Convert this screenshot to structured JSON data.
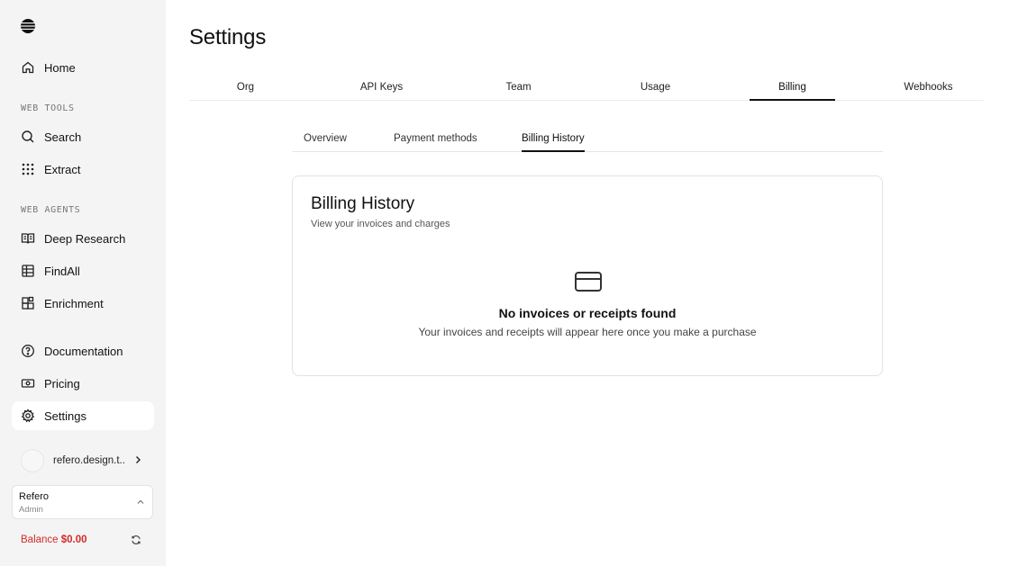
{
  "sidebar": {
    "nav": {
      "home": "Home",
      "search": "Search",
      "extract": "Extract",
      "deep_research": "Deep Research",
      "findall": "FindAll",
      "enrichment": "Enrichment",
      "documentation": "Documentation",
      "pricing": "Pricing",
      "settings": "Settings"
    },
    "sections": {
      "web_tools": "WEB TOOLS",
      "web_agents": "WEB AGENTS"
    },
    "user": {
      "email": "refero.design.t..."
    },
    "org": {
      "name": "Refero",
      "role": "Admin"
    },
    "balance": {
      "label": "Balance",
      "amount": "$0.00"
    }
  },
  "page": {
    "title": "Settings"
  },
  "tabs": [
    {
      "label": "Org",
      "active": false
    },
    {
      "label": "API Keys",
      "active": false
    },
    {
      "label": "Team",
      "active": false
    },
    {
      "label": "Usage",
      "active": false
    },
    {
      "label": "Billing",
      "active": true
    },
    {
      "label": "Webhooks",
      "active": false
    }
  ],
  "subtabs": [
    {
      "label": "Overview",
      "active": false
    },
    {
      "label": "Payment methods",
      "active": false
    },
    {
      "label": "Billing History",
      "active": true
    }
  ],
  "card": {
    "title": "Billing History",
    "subtitle": "View your invoices and charges",
    "empty_title": "No invoices or receipts found",
    "empty_subtitle": "Your invoices and receipts will appear here once you make a purchase"
  },
  "colors": {
    "balance": "#d42a2a",
    "active_tab": "#111111",
    "sidebar_bg": "#f4f4f4"
  }
}
